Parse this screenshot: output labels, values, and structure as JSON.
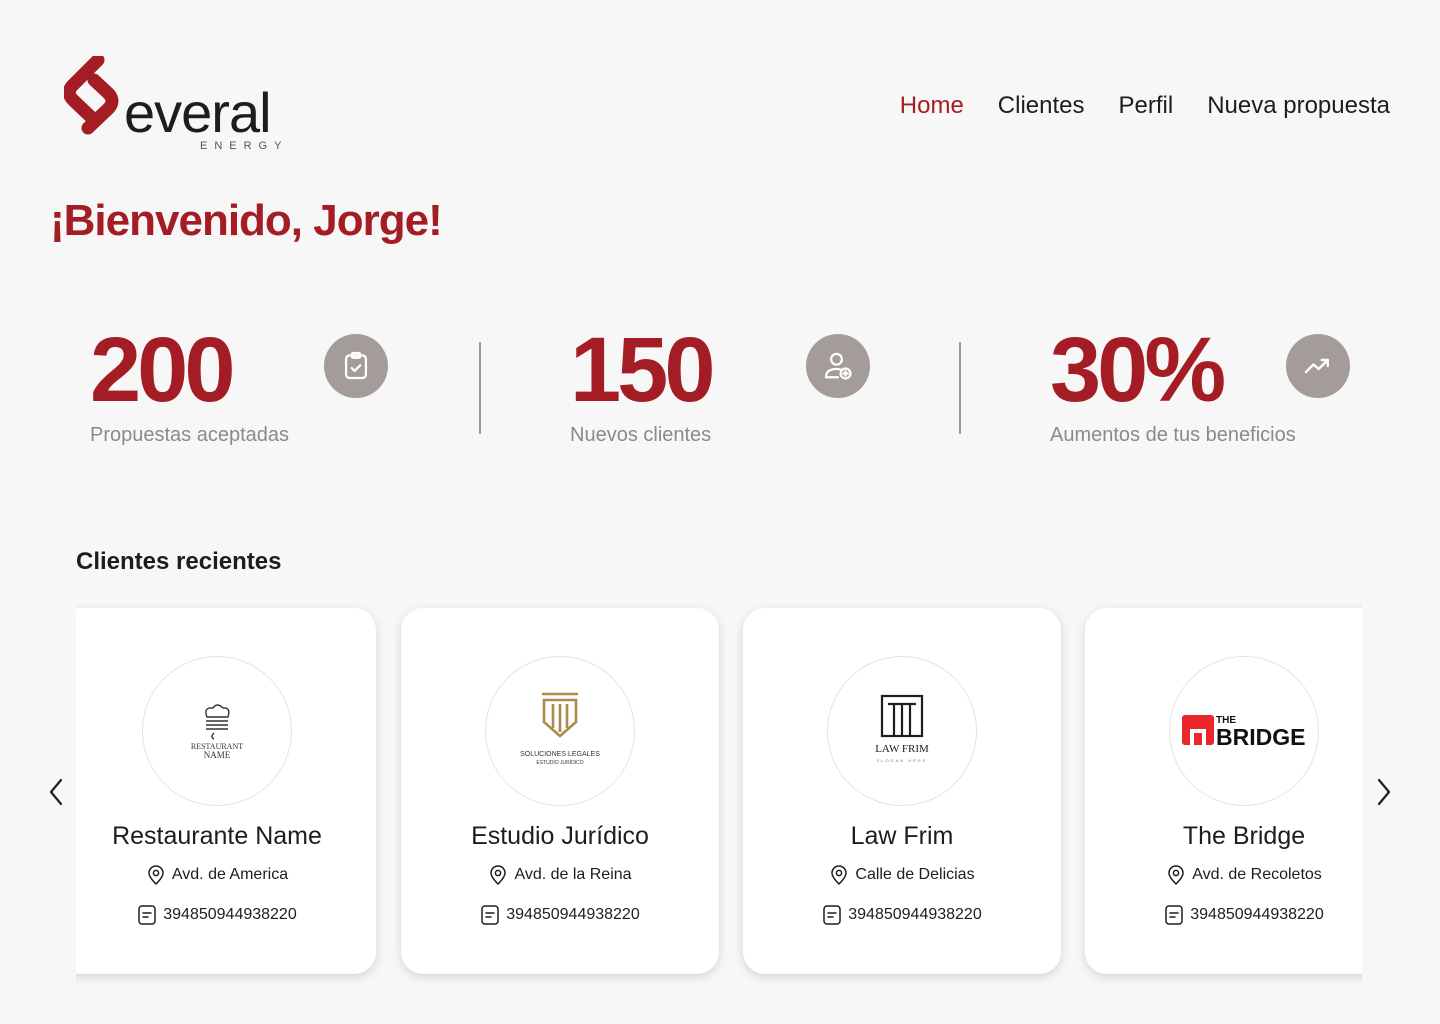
{
  "brand": {
    "word": "everal",
    "subtitle": "ENERGY",
    "accent": "#a51d24"
  },
  "nav": {
    "items": [
      {
        "label": "Home",
        "active": true
      },
      {
        "label": "Clientes",
        "active": false
      },
      {
        "label": "Perfil",
        "active": false
      },
      {
        "label": "Nueva propuesta",
        "active": false
      }
    ]
  },
  "welcome": "¡Bienvenido, Jorge!",
  "stats": [
    {
      "value": "200",
      "label": "Propuestas aceptadas",
      "icon": "clipboard-check-icon"
    },
    {
      "value": "150",
      "label": "Nuevos clientes",
      "icon": "user-add-icon"
    },
    {
      "value": "30%",
      "label": "Aumentos de tus beneficios",
      "icon": "trending-up-icon"
    }
  ],
  "recent": {
    "title": "Clientes recientes",
    "clients": [
      {
        "name": "Restaurante Name",
        "address": "Avd. de America",
        "code": "394850944938220",
        "logo_text": [
          "RESTAURANT",
          "NAME"
        ]
      },
      {
        "name": "Estudio Jurídico",
        "address": "Avd. de la Reina",
        "code": "394850944938220",
        "logo_text": [
          "SOLUCIONES LEGALES",
          "ESTUDIO JURÍDICO"
        ]
      },
      {
        "name": "Law Frim",
        "address": "Calle de Delicias",
        "code": "394850944938220",
        "logo_text": [
          "LAW FRIM",
          "SLOGAN HERE"
        ]
      },
      {
        "name": "The Bridge",
        "address": "Avd. de Recoletos",
        "code": "394850944938220",
        "logo_text": [
          "THE",
          "BRIDGE"
        ]
      }
    ]
  }
}
